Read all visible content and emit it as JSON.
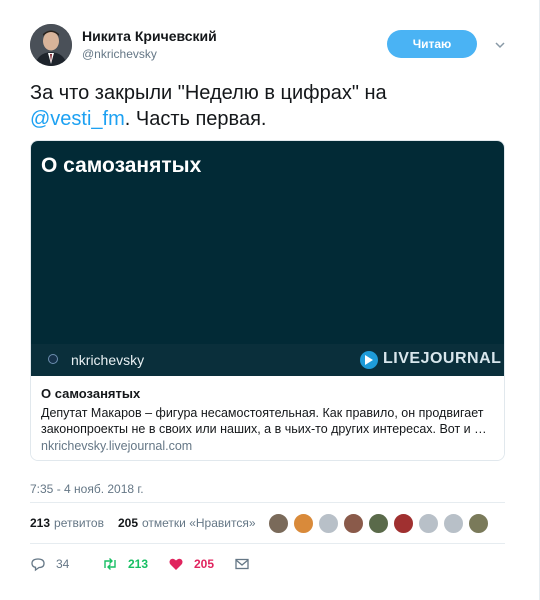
{
  "author": {
    "name": "Никита Кричевский",
    "handle": "@nkrichevsky"
  },
  "follow_button": {
    "label": "Читаю"
  },
  "tweet": {
    "text_part1": "За что закрыли \"Неделю в цифрах\" на",
    "mention": "@vesti_fm",
    "text_part2": ".  Часть первая."
  },
  "card": {
    "image_title": "О самозанятых",
    "image_user": "nkrichevsky",
    "image_brand": "LIVEJOURNAL",
    "title": "О самозанятых",
    "description": "Депутат Макаров – фигура несамостоятельная. Как правило, он продвигает законопроекты не в своих или наших, а в чьих-то других интересах. Вот и …",
    "domain": "nkrichevsky.livejournal.com"
  },
  "timestamp": "7:35 - 4 нояб. 2018 г.",
  "stats": {
    "retweets_count": "213",
    "retweets_label": "ретвитов",
    "likes_count": "205",
    "likes_label": "отметки «Нравится»"
  },
  "likers": [
    {
      "color": "#7a6a5a"
    },
    {
      "color": "#d98a3a"
    },
    {
      "color": "#b8c0c8"
    },
    {
      "color": "#8a5a4a"
    },
    {
      "color": "#5a6a4a"
    },
    {
      "color": "#a03030"
    },
    {
      "color": "#b8c0c8"
    },
    {
      "color": "#b8c0c8"
    },
    {
      "color": "#7a7a5a"
    }
  ],
  "actions": {
    "reply_count": "34",
    "retweet_count": "213",
    "like_count": "205"
  },
  "colors": {
    "accent": "#1da1f2",
    "follow_bg": "#4ab3f4",
    "retweet_green": "#17bf63",
    "like_red": "#e0245e",
    "card_dark": "#022a36"
  }
}
